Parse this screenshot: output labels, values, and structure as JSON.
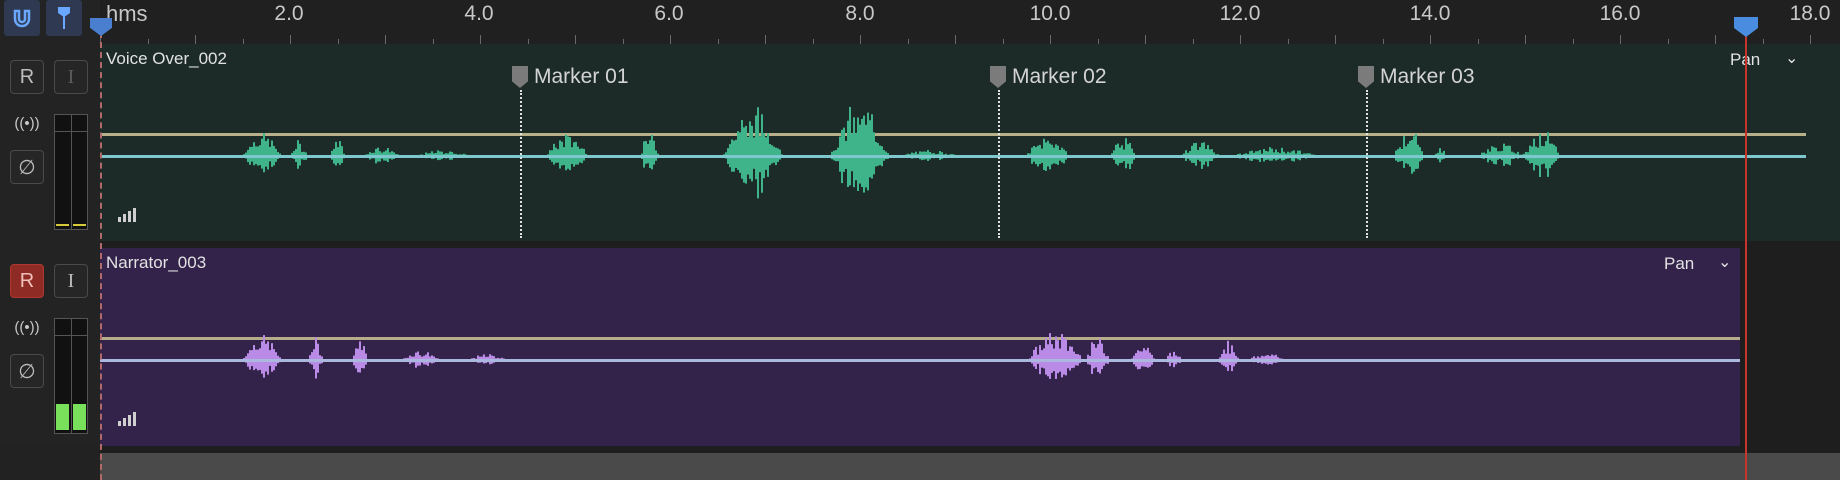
{
  "ruler": {
    "unit": "hms",
    "ticks": [
      "2.0",
      "4.0",
      "6.0",
      "8.0",
      "10.0",
      "12.0",
      "14.0",
      "16.0",
      "18.0"
    ]
  },
  "toolbar": {
    "magnet_icon": "magnet-icon",
    "marker_tool_icon": "pin-icon"
  },
  "tracks": [
    {
      "clip_name": "Voice Over_002",
      "pan_label": "Pan",
      "record_label": "R",
      "input_label": "I",
      "record_active": false,
      "monitor_icon": "((•))",
      "phase_icon": "∅",
      "wave_color": "#3fb48a",
      "vol_line_color": "#b8b08a",
      "pan_line_color": "#7ec7cf"
    },
    {
      "clip_name": "Narrator_003",
      "pan_label": "Pan",
      "record_label": "R",
      "input_label": "I",
      "record_active": true,
      "monitor_icon": "((•))",
      "phase_icon": "∅",
      "wave_color": "#b98be6",
      "vol_line_color": "#b8ad8a",
      "pan_line_color": "#a9b8dc"
    }
  ],
  "markers": [
    {
      "label": "Marker 01"
    },
    {
      "label": "Marker 02"
    },
    {
      "label": "Marker 03"
    }
  ]
}
